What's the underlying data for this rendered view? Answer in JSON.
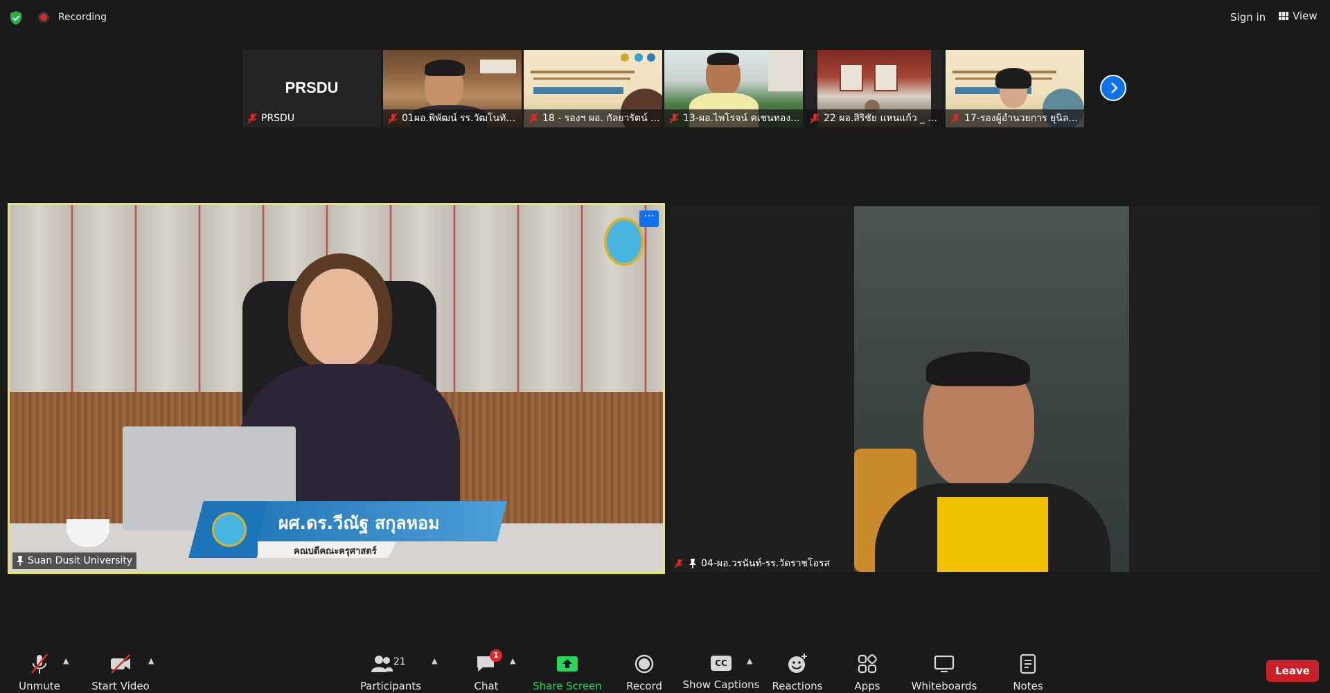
{
  "topbar": {
    "recording_label": "Recording",
    "sign_in": "Sign in",
    "view_label": "View"
  },
  "thumbnails": [
    {
      "name": "PRSDU",
      "big_label": "PRSDU"
    },
    {
      "name": "01ผอ.พิพัฒน์ รร.วัฒโนทัย..."
    },
    {
      "name": "18 - รองฯ ผอ. กัลยารัตน์ ..."
    },
    {
      "name": "13-ผอ.ไพโรจน์ คเชนทอง..."
    },
    {
      "name": "22 ผอ.สิริชัย แหนแก้ว _ ..."
    },
    {
      "name": "17-รองผู้อำนวยการ ยุนิล..."
    }
  ],
  "main_left": {
    "name": "Suan Dusit University",
    "lower_third_name": "ผศ.ดร.วีณัฐ สกุลหอม",
    "lower_third_title": "คณบดีคณะครุศาสตร์",
    "more_label": "···"
  },
  "main_right": {
    "name": "04-ผอ.วรนันท์-รร.วัดราชโอรส"
  },
  "toolbar": {
    "unmute": "Unmute",
    "start_video": "Start Video",
    "participants": "Participants",
    "participants_count": "21",
    "chat": "Chat",
    "chat_badge": "1",
    "share_screen": "Share Screen",
    "record": "Record",
    "show_captions": "Show Captions",
    "captions_icon": "CC",
    "reactions": "Reactions",
    "apps": "Apps",
    "whiteboards": "Whiteboards",
    "notes": "Notes",
    "leave": "Leave"
  },
  "colors": {
    "accent_blue": "#0e72ed",
    "share_green": "#23d959",
    "leave_red": "#c9212a",
    "active_speaker": "#e3e85e"
  }
}
